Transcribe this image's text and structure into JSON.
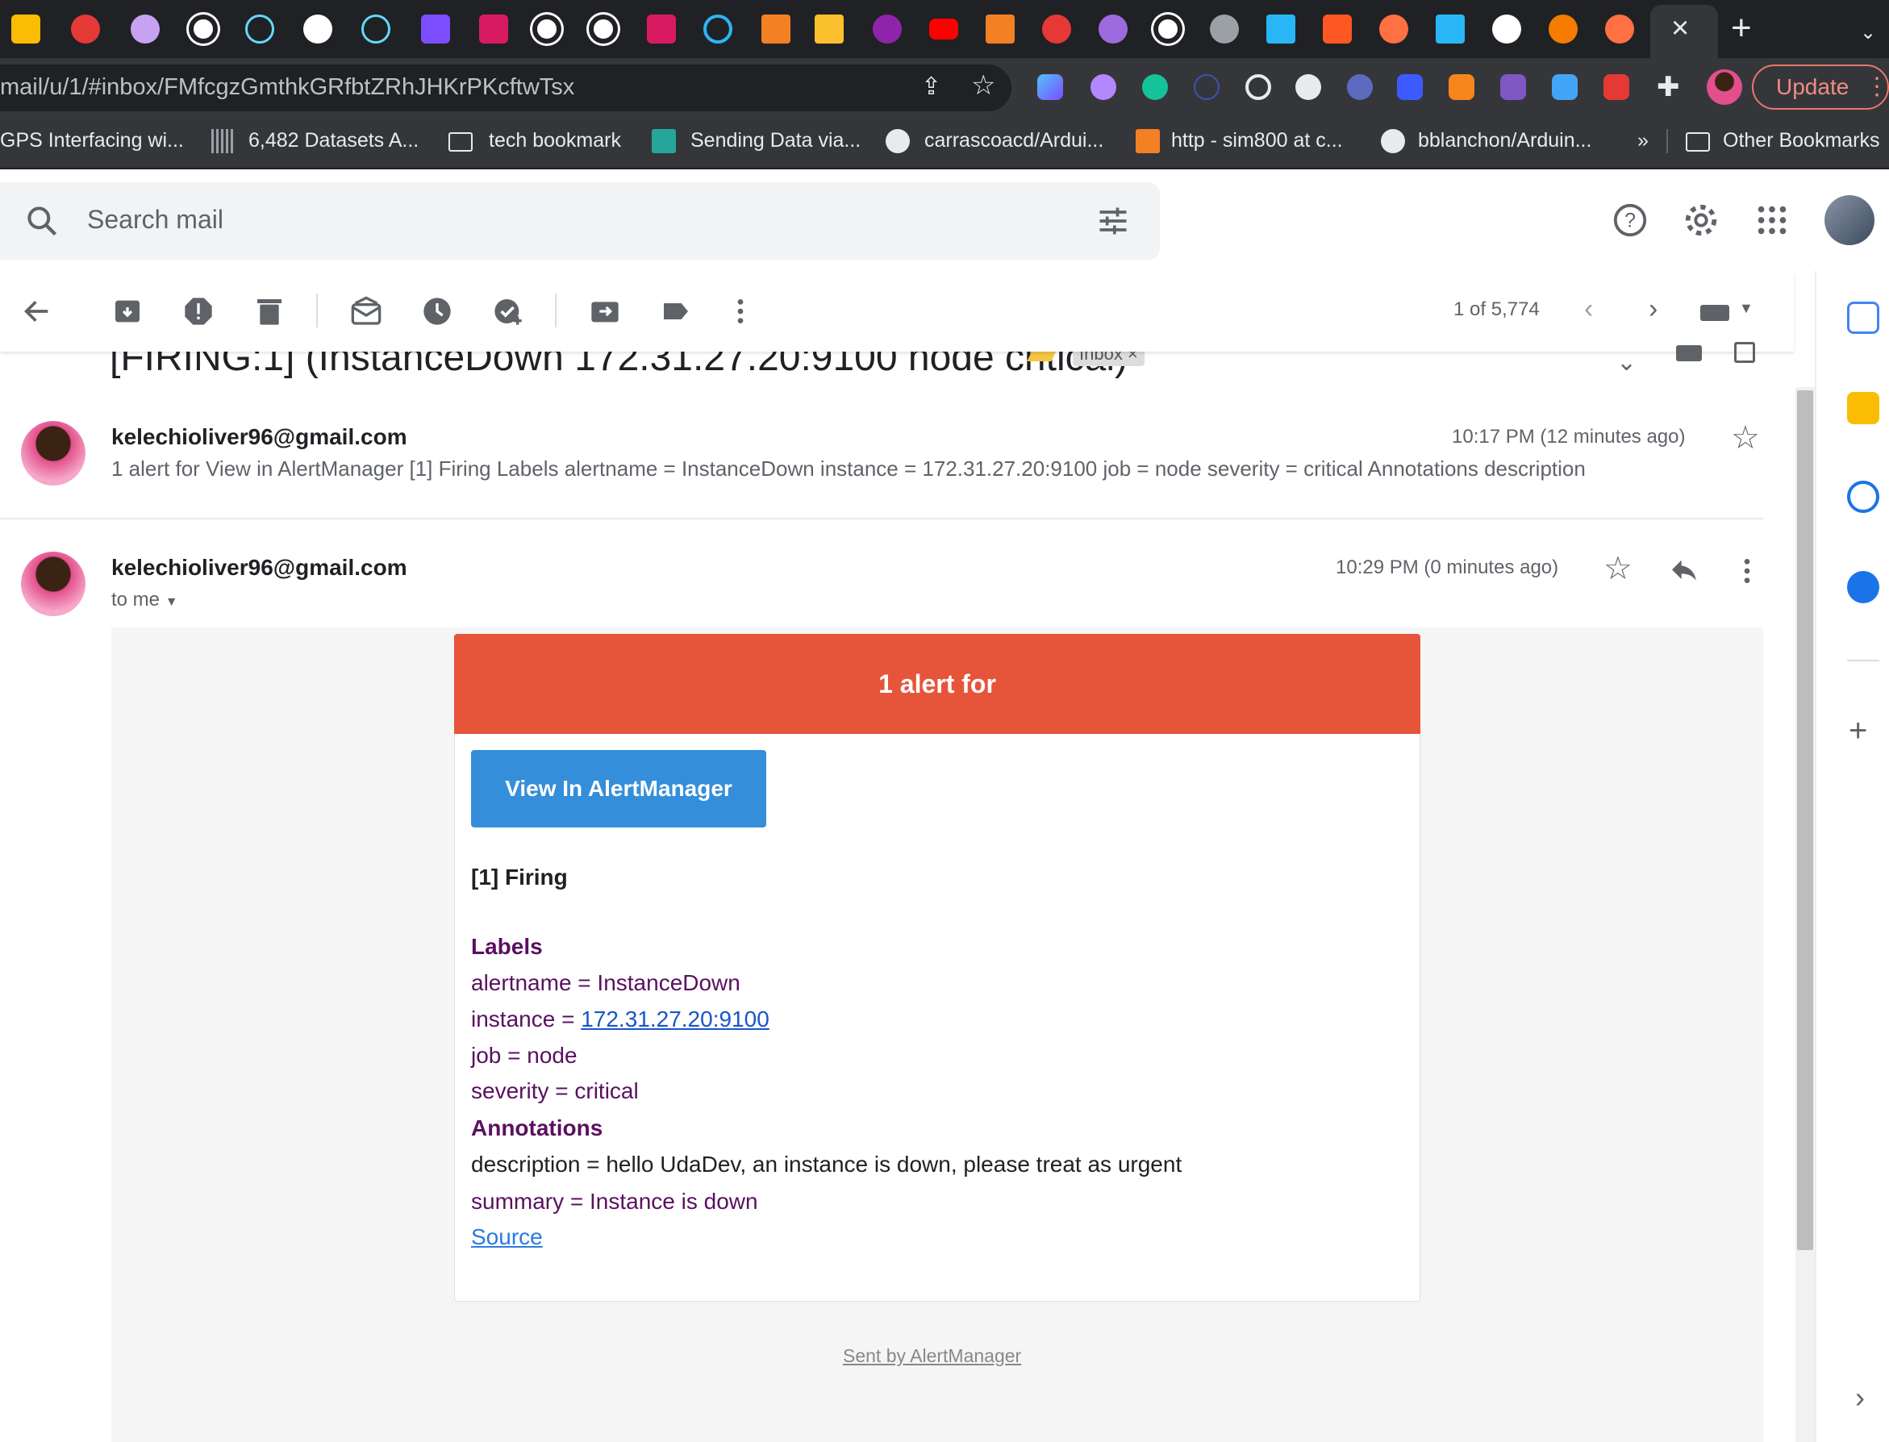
{
  "browser": {
    "url": "mail/u/1/#inbox/FMfcgzGmthkGRfbtZRhJHKrPKcftwTsx",
    "update_label": "Update",
    "tab_close": "×",
    "new_tab": "+",
    "bookmarks": [
      {
        "label": "GPS Interfacing wi...",
        "icon": "page-icon"
      },
      {
        "label": "6,482 Datasets A...",
        "icon": "barcode-icon"
      },
      {
        "label": "tech bookmark",
        "icon": "folder-icon"
      },
      {
        "label": "Sending Data via...",
        "icon": "site-icon"
      },
      {
        "label": "carrascoacd/Ardui...",
        "icon": "github-icon"
      },
      {
        "label": "http - sim800 at c...",
        "icon": "stackoverflow-icon"
      },
      {
        "label": "bblanchon/Arduin...",
        "icon": "github-icon"
      },
      {
        "label": "»",
        "icon": "chevron-double-icon"
      },
      {
        "label": "Other Bookmarks",
        "icon": "folder-icon"
      }
    ]
  },
  "gmail": {
    "search_placeholder": "Search mail",
    "pager": "1 of 5,774",
    "subject": "[FIRING:1] (InstanceDown 172.31.27.20:9100 node critical)",
    "inbox_chip": "Inbox ×",
    "messages": [
      {
        "sender": "kelechioliver96@gmail.com",
        "time": "10:17 PM (12 minutes ago)",
        "snippet": "1 alert for View in AlertManager [1] Firing Labels alertname = InstanceDown instance = 172.31.27.20:9100 job = node severity = critical Annotations description"
      },
      {
        "sender": "kelechioliver96@gmail.com",
        "time": "10:29 PM (0 minutes ago)",
        "to": "to me"
      }
    ]
  },
  "email": {
    "header": "1 alert for",
    "button": "View In AlertManager",
    "firing": "[1] Firing",
    "labels_heading": "Labels",
    "alertname": "alertname = InstanceDown",
    "instance_prefix": "instance = ",
    "instance_link": "172.31.27.20:9100",
    "job": "job = node",
    "severity": "severity = critical",
    "annotations_heading": "Annotations",
    "description": "description = hello UdaDev, an instance is down, please treat as urgent",
    "summary": "summary = Instance is down",
    "source": "Source",
    "sent_by": "Sent by AlertManager"
  },
  "colors": {
    "alert_header": "#e6543a",
    "button": "#348eda",
    "label_text": "#5a1060"
  }
}
